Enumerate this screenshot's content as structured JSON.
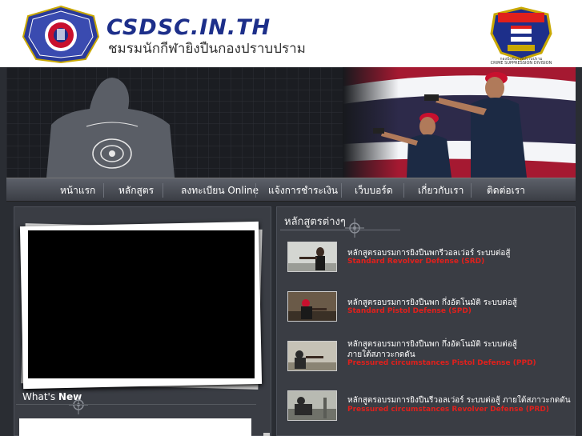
{
  "header": {
    "site_title": "CSDSC.IN.TH",
    "site_subtitle": "ชมรมนักกีฬายิงปืนกองปราบปราม",
    "club_logo_icon": "club-seal-icon",
    "police_logo_icon": "police-badge-icon",
    "police_caption_line1": "กองบังคับการปราบปราม",
    "police_caption_line2": "CRIME SUPPRESSION DIVISION"
  },
  "nav": {
    "items": [
      {
        "label": "หน้าแรก"
      },
      {
        "label": "หลักสูตร"
      },
      {
        "label": "ลงทะเบียน Online"
      },
      {
        "label": "แจ้งการชำระเงิน"
      },
      {
        "label": "เว็บบอร์ด"
      },
      {
        "label": "เกี่ยวกับเรา"
      },
      {
        "label": "ติดต่อเรา"
      }
    ]
  },
  "left": {
    "whats_prefix": "What's",
    "whats_bold": "New"
  },
  "right": {
    "heading": "หลักสูตรต่างๆ",
    "courses": [
      {
        "title": "หลักสูตรอบรมการยิงปืนพกรีวอลเว่อร์ ระบบต่อสู้",
        "title2": "",
        "subtitle": "Standard Revolver Defense (SRD)"
      },
      {
        "title": "หลักสูตรอบรมการยิงปืนพก กึ่งอัตโนมัติ ระบบต่อสู้",
        "title2": "",
        "subtitle": "Standard Pistol Defense (SPD)"
      },
      {
        "title": "หลักสูตรอบรมการยิงปืนพก กึ่งอัตโนมัติ ระบบต่อสู้",
        "title2": "ภายใต้สภาวะกดดัน",
        "subtitle": "Pressured circumstances Pistol Defense (PPD)"
      },
      {
        "title": "หลักสูตรอบรมการยิงปืนรีวอลเว่อร์ ระบบต่อสู้ ภายใต้สภาวะกดดัน",
        "title2": "",
        "subtitle": "Pressured circumstances Revolver Defense (PRD)"
      }
    ]
  },
  "colors": {
    "title_blue": "#1d2f8a",
    "accent_red": "#e0201c",
    "panel": "#3a3d44"
  }
}
